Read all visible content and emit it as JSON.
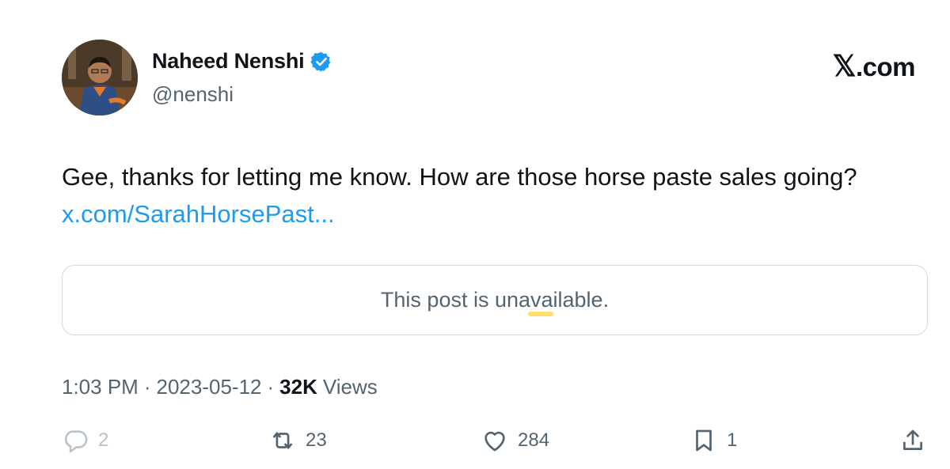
{
  "author": {
    "name": "Naheed Nenshi",
    "handle": "@nenshi",
    "verified": true,
    "verified_color": "#1d9bf0"
  },
  "brand": {
    "logo_icon": "x-logo-icon",
    "suffix": ".com"
  },
  "post": {
    "text": "Gee, thanks for letting me know. How are those horse paste sales going?",
    "link_text": "x.com/SarahHorsePast..."
  },
  "quoted_post": {
    "message": "This post is unavailable."
  },
  "meta": {
    "time": "1:03 PM",
    "separator": "·",
    "date": "2023-05-12",
    "views_count": "32K",
    "views_label": "Views"
  },
  "actions": {
    "replies": "2",
    "reposts": "23",
    "likes": "284",
    "bookmarks": "1"
  },
  "colors": {
    "link": "#1d9bf0",
    "text": "#0f1419",
    "secondary_text": "#536471",
    "border": "#cfd9de"
  }
}
